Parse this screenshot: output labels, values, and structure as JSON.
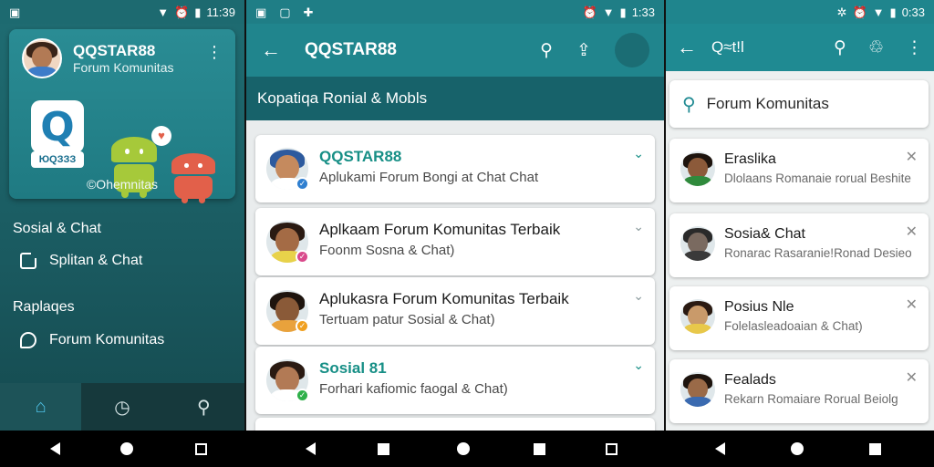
{
  "panel1": {
    "status": {
      "time": "11:39"
    },
    "card": {
      "title": "QQSTAR88",
      "subtitle": "Forum Komunitas",
      "logo_letter": "Q",
      "logo_tag": "ЮQЗЗЗ",
      "bubble": "♥",
      "footer": "©Ohemnitas"
    },
    "section1": "Sosial & Chat",
    "item1": "Splitan & Chat",
    "section2": "Raplaqes",
    "item2": "Forum Komunitas",
    "bottom_nav": [
      "home-icon",
      "activity-icon",
      "search-icon"
    ]
  },
  "panel2": {
    "status": {
      "time": "1:33"
    },
    "title": "QQSTAR88",
    "banner": "Kopatiqa  Ronial & Mobls",
    "items": [
      {
        "title": "QQSTAR88",
        "subtitle": "Aplukami Forum Bongi at Chat Chat",
        "accent": true,
        "badge_color": "#2f7fd0"
      },
      {
        "title": "Aplkaam Forum Komunitas Terbaik",
        "subtitle": "Foonm Sosna & Chat)",
        "accent": false,
        "badge_color": "#d94a8c"
      },
      {
        "title": "Aplukasra Forum Komunitas Terbaik",
        "subtitle": "Tertuam patur Sosial & Chat)",
        "accent": false,
        "badge_color": "#f0a020"
      },
      {
        "title": "Sosial 81",
        "subtitle": "Forhari kafiomic faogal & Chat)",
        "accent": true,
        "badge_color": "#2fb04a"
      }
    ]
  },
  "panel3": {
    "status": {
      "time": "0:33"
    },
    "title": "Q≈t!l",
    "search_value": "Forum Komunitas",
    "items": [
      {
        "title": "Eraslika",
        "subtitle": "Dlolaans Romanaie rorual Beshite"
      },
      {
        "title": "Sosia& Chat",
        "subtitle": "Ronarac Rasaranie!Ronad Desieo"
      },
      {
        "title": "Posius Nle",
        "subtitle": "Folelasleadoaian & Chat)"
      },
      {
        "title": "Fealads",
        "subtitle": "Rekarn Romaiare Rorual Beiolg"
      }
    ]
  },
  "colors": {
    "teal": "#1f858d",
    "accent": "#178f86",
    "drawer": "#1a5a60"
  }
}
